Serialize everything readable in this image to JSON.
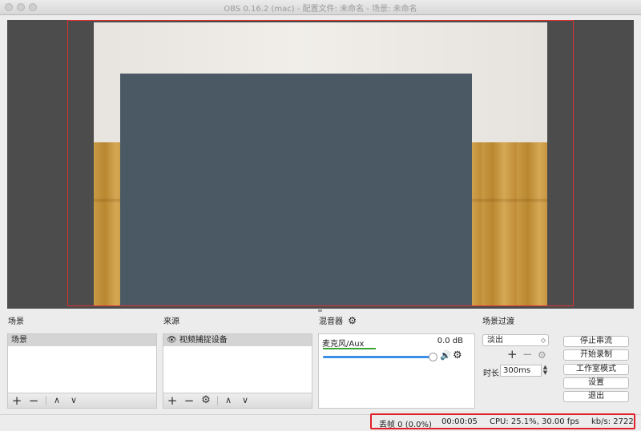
{
  "window": {
    "title": "OBS 0.16.2 (mac) - 配置文件: 未命名 - 场景: 未命名"
  },
  "docks": {
    "scenes": {
      "title": "场景",
      "items": [
        "场景"
      ]
    },
    "sources": {
      "title": "来源",
      "items": [
        {
          "label": "视频捕捉设备",
          "icon": "eye-icon"
        }
      ]
    },
    "mixer": {
      "title": "混音器",
      "channel": {
        "name": "麦克风/Aux",
        "level": "0.0 dB",
        "volume": 1.0,
        "meter": 0.48
      }
    },
    "transitions": {
      "title": "场景过渡",
      "selected": "淡出",
      "duration_label": "时长",
      "duration_value": "300ms"
    }
  },
  "controls": {
    "stop_stream": "停止串流",
    "start_recording": "开始录制",
    "studio_mode": "工作室模式",
    "settings": "设置",
    "exit": "退出"
  },
  "toolbar_icons": {
    "add": "+",
    "remove": "−",
    "up": "∧",
    "down": "∨",
    "gear": "⚙"
  },
  "status": {
    "dropped": "丢帧 0 (0.0%)",
    "time": "00:00:05",
    "cpu": "CPU: 25.1%, 30.00 fps",
    "kbps": "kb/s: 2722"
  },
  "colors": {
    "preview_bg": "#4c4c4c",
    "video_rect": "#4a5964",
    "highlight": "#e0202a",
    "accent": "#3b8fe6"
  }
}
